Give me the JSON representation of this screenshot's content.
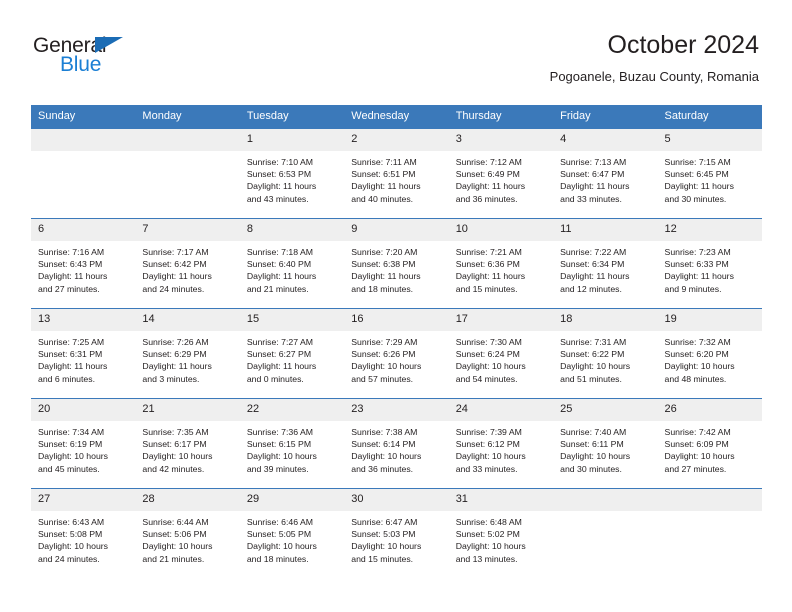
{
  "brand": {
    "name_part1": "General",
    "name_part2": "Blue",
    "triangle_color": "#1b6cb5",
    "blue_color": "#1b7fd4"
  },
  "header": {
    "title": "October 2024",
    "subtitle": "Pogoanele, Buzau County, Romania"
  },
  "theme": {
    "header_bg": "#3b79ba",
    "daynum_bg": "#efefef",
    "row_border": "#3b79ba",
    "text": "#231f20"
  },
  "weekdays": [
    "Sunday",
    "Monday",
    "Tuesday",
    "Wednesday",
    "Thursday",
    "Friday",
    "Saturday"
  ],
  "labels": {
    "sunrise_prefix": "Sunrise:",
    "sunset_prefix": "Sunset:",
    "daylight_prefix": "Daylight:"
  },
  "weeks": [
    [
      {
        "day": "",
        "empty": true
      },
      {
        "day": "",
        "empty": true
      },
      {
        "day": "1",
        "sunrise": "Sunrise: 7:10 AM",
        "sunset": "Sunset: 6:53 PM",
        "daylight_line1": "Daylight: 11 hours",
        "daylight_line2": "and 43 minutes."
      },
      {
        "day": "2",
        "sunrise": "Sunrise: 7:11 AM",
        "sunset": "Sunset: 6:51 PM",
        "daylight_line1": "Daylight: 11 hours",
        "daylight_line2": "and 40 minutes."
      },
      {
        "day": "3",
        "sunrise": "Sunrise: 7:12 AM",
        "sunset": "Sunset: 6:49 PM",
        "daylight_line1": "Daylight: 11 hours",
        "daylight_line2": "and 36 minutes."
      },
      {
        "day": "4",
        "sunrise": "Sunrise: 7:13 AM",
        "sunset": "Sunset: 6:47 PM",
        "daylight_line1": "Daylight: 11 hours",
        "daylight_line2": "and 33 minutes."
      },
      {
        "day": "5",
        "sunrise": "Sunrise: 7:15 AM",
        "sunset": "Sunset: 6:45 PM",
        "daylight_line1": "Daylight: 11 hours",
        "daylight_line2": "and 30 minutes."
      }
    ],
    [
      {
        "day": "6",
        "sunrise": "Sunrise: 7:16 AM",
        "sunset": "Sunset: 6:43 PM",
        "daylight_line1": "Daylight: 11 hours",
        "daylight_line2": "and 27 minutes."
      },
      {
        "day": "7",
        "sunrise": "Sunrise: 7:17 AM",
        "sunset": "Sunset: 6:42 PM",
        "daylight_line1": "Daylight: 11 hours",
        "daylight_line2": "and 24 minutes."
      },
      {
        "day": "8",
        "sunrise": "Sunrise: 7:18 AM",
        "sunset": "Sunset: 6:40 PM",
        "daylight_line1": "Daylight: 11 hours",
        "daylight_line2": "and 21 minutes."
      },
      {
        "day": "9",
        "sunrise": "Sunrise: 7:20 AM",
        "sunset": "Sunset: 6:38 PM",
        "daylight_line1": "Daylight: 11 hours",
        "daylight_line2": "and 18 minutes."
      },
      {
        "day": "10",
        "sunrise": "Sunrise: 7:21 AM",
        "sunset": "Sunset: 6:36 PM",
        "daylight_line1": "Daylight: 11 hours",
        "daylight_line2": "and 15 minutes."
      },
      {
        "day": "11",
        "sunrise": "Sunrise: 7:22 AM",
        "sunset": "Sunset: 6:34 PM",
        "daylight_line1": "Daylight: 11 hours",
        "daylight_line2": "and 12 minutes."
      },
      {
        "day": "12",
        "sunrise": "Sunrise: 7:23 AM",
        "sunset": "Sunset: 6:33 PM",
        "daylight_line1": "Daylight: 11 hours",
        "daylight_line2": "and 9 minutes."
      }
    ],
    [
      {
        "day": "13",
        "sunrise": "Sunrise: 7:25 AM",
        "sunset": "Sunset: 6:31 PM",
        "daylight_line1": "Daylight: 11 hours",
        "daylight_line2": "and 6 minutes."
      },
      {
        "day": "14",
        "sunrise": "Sunrise: 7:26 AM",
        "sunset": "Sunset: 6:29 PM",
        "daylight_line1": "Daylight: 11 hours",
        "daylight_line2": "and 3 minutes."
      },
      {
        "day": "15",
        "sunrise": "Sunrise: 7:27 AM",
        "sunset": "Sunset: 6:27 PM",
        "daylight_line1": "Daylight: 11 hours",
        "daylight_line2": "and 0 minutes."
      },
      {
        "day": "16",
        "sunrise": "Sunrise: 7:29 AM",
        "sunset": "Sunset: 6:26 PM",
        "daylight_line1": "Daylight: 10 hours",
        "daylight_line2": "and 57 minutes."
      },
      {
        "day": "17",
        "sunrise": "Sunrise: 7:30 AM",
        "sunset": "Sunset: 6:24 PM",
        "daylight_line1": "Daylight: 10 hours",
        "daylight_line2": "and 54 minutes."
      },
      {
        "day": "18",
        "sunrise": "Sunrise: 7:31 AM",
        "sunset": "Sunset: 6:22 PM",
        "daylight_line1": "Daylight: 10 hours",
        "daylight_line2": "and 51 minutes."
      },
      {
        "day": "19",
        "sunrise": "Sunrise: 7:32 AM",
        "sunset": "Sunset: 6:20 PM",
        "daylight_line1": "Daylight: 10 hours",
        "daylight_line2": "and 48 minutes."
      }
    ],
    [
      {
        "day": "20",
        "sunrise": "Sunrise: 7:34 AM",
        "sunset": "Sunset: 6:19 PM",
        "daylight_line1": "Daylight: 10 hours",
        "daylight_line2": "and 45 minutes."
      },
      {
        "day": "21",
        "sunrise": "Sunrise: 7:35 AM",
        "sunset": "Sunset: 6:17 PM",
        "daylight_line1": "Daylight: 10 hours",
        "daylight_line2": "and 42 minutes."
      },
      {
        "day": "22",
        "sunrise": "Sunrise: 7:36 AM",
        "sunset": "Sunset: 6:15 PM",
        "daylight_line1": "Daylight: 10 hours",
        "daylight_line2": "and 39 minutes."
      },
      {
        "day": "23",
        "sunrise": "Sunrise: 7:38 AM",
        "sunset": "Sunset: 6:14 PM",
        "daylight_line1": "Daylight: 10 hours",
        "daylight_line2": "and 36 minutes."
      },
      {
        "day": "24",
        "sunrise": "Sunrise: 7:39 AM",
        "sunset": "Sunset: 6:12 PM",
        "daylight_line1": "Daylight: 10 hours",
        "daylight_line2": "and 33 minutes."
      },
      {
        "day": "25",
        "sunrise": "Sunrise: 7:40 AM",
        "sunset": "Sunset: 6:11 PM",
        "daylight_line1": "Daylight: 10 hours",
        "daylight_line2": "and 30 minutes."
      },
      {
        "day": "26",
        "sunrise": "Sunrise: 7:42 AM",
        "sunset": "Sunset: 6:09 PM",
        "daylight_line1": "Daylight: 10 hours",
        "daylight_line2": "and 27 minutes."
      }
    ],
    [
      {
        "day": "27",
        "sunrise": "Sunrise: 6:43 AM",
        "sunset": "Sunset: 5:08 PM",
        "daylight_line1": "Daylight: 10 hours",
        "daylight_line2": "and 24 minutes."
      },
      {
        "day": "28",
        "sunrise": "Sunrise: 6:44 AM",
        "sunset": "Sunset: 5:06 PM",
        "daylight_line1": "Daylight: 10 hours",
        "daylight_line2": "and 21 minutes."
      },
      {
        "day": "29",
        "sunrise": "Sunrise: 6:46 AM",
        "sunset": "Sunset: 5:05 PM",
        "daylight_line1": "Daylight: 10 hours",
        "daylight_line2": "and 18 minutes."
      },
      {
        "day": "30",
        "sunrise": "Sunrise: 6:47 AM",
        "sunset": "Sunset: 5:03 PM",
        "daylight_line1": "Daylight: 10 hours",
        "daylight_line2": "and 15 minutes."
      },
      {
        "day": "31",
        "sunrise": "Sunrise: 6:48 AM",
        "sunset": "Sunset: 5:02 PM",
        "daylight_line1": "Daylight: 10 hours",
        "daylight_line2": "and 13 minutes."
      },
      {
        "day": "",
        "empty": true
      },
      {
        "day": "",
        "empty": true
      }
    ]
  ]
}
